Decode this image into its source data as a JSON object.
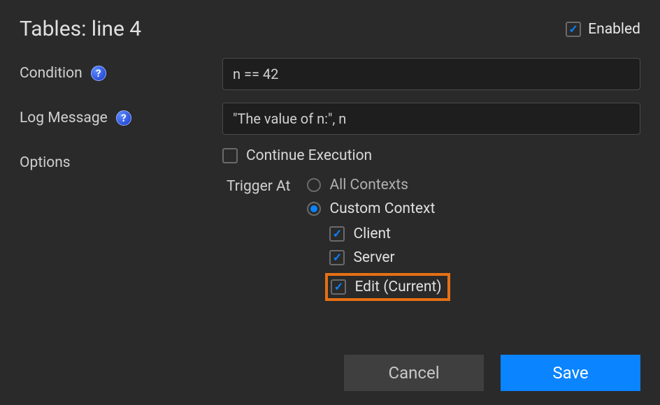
{
  "title": "Tables: line 4",
  "enabled": {
    "label": "Enabled",
    "checked": true
  },
  "condition": {
    "label": "Condition",
    "value": "n == 42"
  },
  "logMessage": {
    "label": "Log Message",
    "value": "\"The value of n:\", n"
  },
  "options": {
    "label": "Options",
    "continueExecution": {
      "label": "Continue Execution",
      "checked": false
    },
    "triggerAt": {
      "label": "Trigger At",
      "selected": "custom",
      "allContexts": {
        "label": "All Contexts"
      },
      "customContext": {
        "label": "Custom Context",
        "contexts": {
          "client": {
            "label": "Client",
            "checked": true
          },
          "server": {
            "label": "Server",
            "checked": true
          },
          "edit": {
            "label": "Edit (Current)",
            "checked": true
          }
        }
      }
    }
  },
  "buttons": {
    "cancel": "Cancel",
    "save": "Save"
  }
}
